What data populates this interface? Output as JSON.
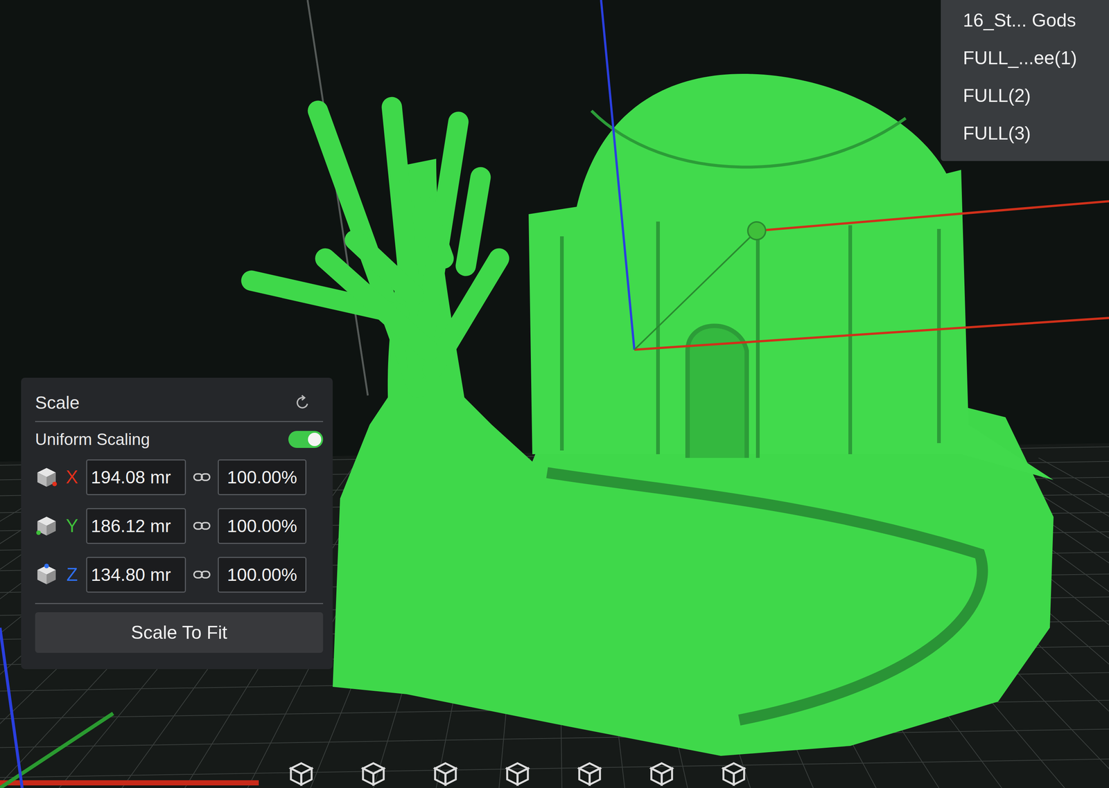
{
  "object_list": {
    "items": [
      {
        "label": "16_St... Gods"
      },
      {
        "label": "FULL_...ee(1)"
      },
      {
        "label": "FULL(2)"
      },
      {
        "label": "FULL(3)"
      }
    ]
  },
  "scale_panel": {
    "title": "Scale",
    "uniform_scaling": {
      "label": "Uniform Scaling",
      "on": true
    },
    "axes": [
      {
        "axis": "X",
        "value": "194.08 mr",
        "percent": "100.00%",
        "color": "#e3301c"
      },
      {
        "axis": "Y",
        "value": "186.12 mr",
        "percent": "100.00%",
        "color": "#3fbf3a"
      },
      {
        "axis": "Z",
        "value": "134.80 mr",
        "percent": "100.00%",
        "color": "#2f6ff0"
      }
    ],
    "button": "Scale To Fit"
  }
}
